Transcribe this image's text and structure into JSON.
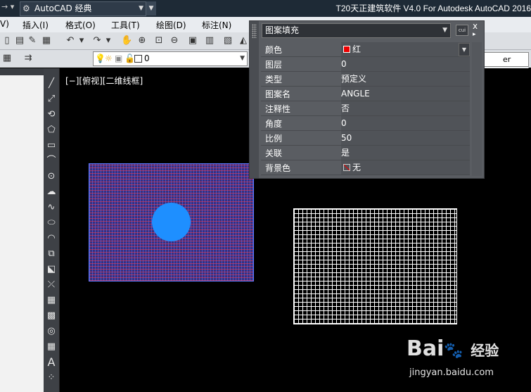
{
  "app": {
    "title": "T20天正建筑软件 V4.0 For Autodesk AutoCAD 2016",
    "workspace": "AutoCAD 经典"
  },
  "menu": {
    "items": [
      "V)",
      "插入(I)",
      "格式(O)",
      "工具(T)",
      "绘图(D)",
      "标注(N)"
    ]
  },
  "layer_toolbar": {
    "current_layer": "0"
  },
  "right_combo": {
    "text": "er"
  },
  "viewport": {
    "label": "[−][俯视][二维线框]"
  },
  "properties": {
    "object_type": "图案填充",
    "rows": [
      {
        "name": "颜色",
        "value": "红"
      },
      {
        "name": "图层",
        "value": "0"
      },
      {
        "name": "类型",
        "value": "预定义"
      },
      {
        "name": "图案名",
        "value": "ANGLE"
      },
      {
        "name": "注释性",
        "value": "否"
      },
      {
        "name": "角度",
        "value": "0"
      },
      {
        "name": "比例",
        "value": "50"
      },
      {
        "name": "关联",
        "value": "是"
      },
      {
        "name": "背景色",
        "value": "无"
      }
    ],
    "quick_select_label": "cui",
    "close_glyph": "x"
  },
  "colors": {
    "hatch_fill": "#3a2f7d",
    "circle": "#1e8fff",
    "color_swatch": "#e00000",
    "canvas": "#000000"
  },
  "watermark": {
    "logo": "Bai",
    "logo_sub": "经验",
    "url": "jingyan.baidu.com"
  }
}
